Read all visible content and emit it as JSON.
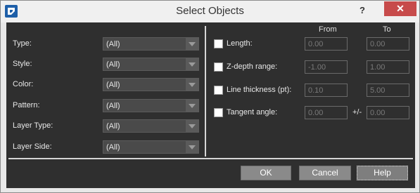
{
  "window": {
    "title": "Select Objects",
    "help_glyph": "?",
    "close_glyph": "✕",
    "app_icon": "app-logo-icon"
  },
  "left": {
    "rows": [
      {
        "label": "Type:",
        "value": "(All)"
      },
      {
        "label": "Style:",
        "value": "(All)"
      },
      {
        "label": "Color:",
        "value": "(All)"
      },
      {
        "label": "Pattern:",
        "value": "(All)"
      },
      {
        "label": "Layer Type:",
        "value": "(All)"
      },
      {
        "label": "Layer Side:",
        "value": "(All)"
      }
    ]
  },
  "right": {
    "from_header": "From",
    "to_header": "To",
    "rows": [
      {
        "label": "Length:",
        "from": "0.00",
        "to": "0.00",
        "checked": false
      },
      {
        "label": "Z-depth range:",
        "from": "-1.00",
        "to": "1.00",
        "checked": false
      },
      {
        "label": "Line thickness (pt):",
        "from": "0.10",
        "to": "5.00",
        "checked": false
      },
      {
        "label": "Tangent angle:",
        "from": "0.00",
        "to": "0.00",
        "checked": false,
        "separator": "+/-"
      }
    ]
  },
  "buttons": {
    "ok": "OK",
    "cancel": "Cancel",
    "help": "Help"
  },
  "colors": {
    "panel": "#2f2f2f",
    "close": "#c74b4b",
    "button": "#8a8a8a"
  }
}
